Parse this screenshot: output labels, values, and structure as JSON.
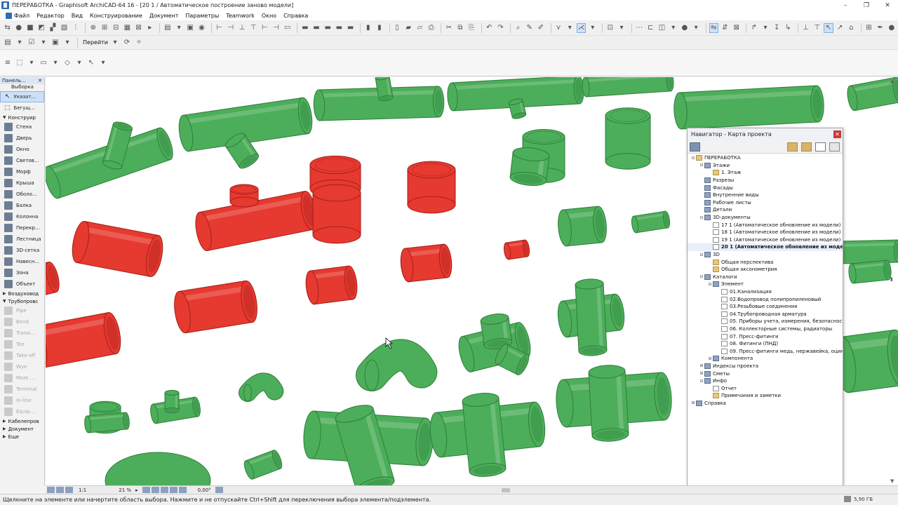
{
  "window": {
    "title": "ПЕРЕРАБОТКА - Graphisoft ArchiCAD-64 16 - [20 1 / Автоматическое построение заново модели]",
    "controls": [
      "–",
      "❐",
      "✕"
    ]
  },
  "menu": [
    "Файл",
    "Редактор",
    "Вид",
    "Конструирование",
    "Документ",
    "Параметры",
    "Teamwork",
    "Окно",
    "Справка"
  ],
  "toolbar": {
    "goto_label": "Перейти"
  },
  "toolbox": {
    "panel_label": "Панель...",
    "selection_header": "Выборка",
    "pointer": "Указат...",
    "marquee": "Бегущ...",
    "design_header": "Конструир",
    "design_items": [
      "Стена",
      "Дверь",
      "Окно",
      "Светов...",
      "Морф",
      "Крыша",
      "Оболо...",
      "Балка",
      "Колонна",
      "Перекр...",
      "Лестница",
      "3D-сетка",
      "Навесн...",
      "Зона",
      "Объект"
    ],
    "ducts_group": "Воздуховод",
    "pipes_group": "Трубопровс",
    "pipe_items": [
      "Pipe",
      "Bend",
      "Transi...",
      "Tee",
      "Take-off",
      "Wye",
      "More ...",
      "Terminal",
      "In-line",
      "Equip..."
    ],
    "cable_group": "Кабелепров",
    "document_group": "Документ",
    "more_group": "Еще"
  },
  "navigator": {
    "title": "Навигатор - Карта проекта",
    "tree": [
      {
        "label": "ПЕРЕРАБОТКА",
        "level": 0,
        "exp": "⊟",
        "icon": "folder"
      },
      {
        "label": "Этажи",
        "level": 1,
        "exp": "⊟",
        "icon": "cat"
      },
      {
        "label": "1. Этаж",
        "level": 2,
        "exp": "",
        "icon": "folder"
      },
      {
        "label": "Разрезы",
        "level": 1,
        "exp": "",
        "icon": "cat"
      },
      {
        "label": "Фасады",
        "level": 1,
        "exp": "",
        "icon": "cat"
      },
      {
        "label": "Внутренние виды",
        "level": 1,
        "exp": "",
        "icon": "cat"
      },
      {
        "label": "Рабочие листы",
        "level": 1,
        "exp": "",
        "icon": "cat"
      },
      {
        "label": "Детали",
        "level": 1,
        "exp": "",
        "icon": "cat"
      },
      {
        "label": "3D-документы",
        "level": 1,
        "exp": "⊟",
        "icon": "cat"
      },
      {
        "label": "17 1 (Автоматическое обновление из модели)",
        "level": 2,
        "exp": "",
        "icon": "doc"
      },
      {
        "label": "18 1 (Автоматическое обновление из модели)",
        "level": 2,
        "exp": "",
        "icon": "doc"
      },
      {
        "label": "19 1 (Автоматическое обновление из модели)",
        "level": 2,
        "exp": "",
        "icon": "doc"
      },
      {
        "label": "20 1 (Автоматическое обновление из моде",
        "level": 2,
        "exp": "",
        "icon": "doc",
        "bold": true
      },
      {
        "label": "3D",
        "level": 1,
        "exp": "⊟",
        "icon": "cat"
      },
      {
        "label": "Общая перспектива",
        "level": 2,
        "exp": "",
        "icon": "folder"
      },
      {
        "label": "Общая аксонометрия",
        "level": 2,
        "exp": "",
        "icon": "folder"
      },
      {
        "label": "Каталоги",
        "level": 1,
        "exp": "⊟",
        "icon": "cat"
      },
      {
        "label": "Элемент",
        "level": 2,
        "exp": "⊟",
        "icon": "cat"
      },
      {
        "label": "01.Канализация",
        "level": 3,
        "exp": "",
        "icon": "doc"
      },
      {
        "label": "02.Водопровод полипропиленовый",
        "level": 3,
        "exp": "",
        "icon": "doc"
      },
      {
        "label": "03.Резьбовые соединения",
        "level": 3,
        "exp": "",
        "icon": "doc"
      },
      {
        "label": "04.Трубопроводная арматура",
        "level": 3,
        "exp": "",
        "icon": "doc"
      },
      {
        "label": "05. Приборы учета, измерения, безопасности",
        "level": 3,
        "exp": "",
        "icon": "doc"
      },
      {
        "label": "06. Коллекторные системы, радиаторы",
        "level": 3,
        "exp": "",
        "icon": "doc"
      },
      {
        "label": "07. Пресс-фитинги",
        "level": 3,
        "exp": "",
        "icon": "doc"
      },
      {
        "label": "08. Фитинги (ПНД)",
        "level": 3,
        "exp": "",
        "icon": "doc"
      },
      {
        "label": "09. Пресс-фитинги медь, нержавейка, оцинко",
        "level": 3,
        "exp": "",
        "icon": "doc"
      },
      {
        "label": "Компонента",
        "level": 2,
        "exp": "⊞",
        "icon": "cat"
      },
      {
        "label": "Индексы проекта",
        "level": 1,
        "exp": "⊞",
        "icon": "cat"
      },
      {
        "label": "Сметы",
        "level": 1,
        "exp": "⊞",
        "icon": "cat"
      },
      {
        "label": "Инфо",
        "level": 1,
        "exp": "⊟",
        "icon": "cat"
      },
      {
        "label": "Отчет",
        "level": 2,
        "exp": "",
        "icon": "doc"
      },
      {
        "label": "Примечания и заметки",
        "level": 2,
        "exp": "",
        "icon": "folder"
      },
      {
        "label": "Справка",
        "level": 0,
        "exp": "⊞",
        "icon": "cat"
      }
    ]
  },
  "viewport_footer": {
    "scale": "1:1",
    "zoom": "21 %",
    "angle": "0,00°"
  },
  "status": {
    "message": "Щелкните на элементе или начертите область выбора. Нажмите и не отпускайте Ctrl+Shift для переключения выбора элемента/подэлемента.",
    "disk": "5,90 ГБ"
  },
  "colors": {
    "fitting_green": "#4cae5a",
    "fitting_green_dark": "#2f7d3b",
    "fitting_red": "#e6392f",
    "fitting_red_dark": "#a32019"
  }
}
